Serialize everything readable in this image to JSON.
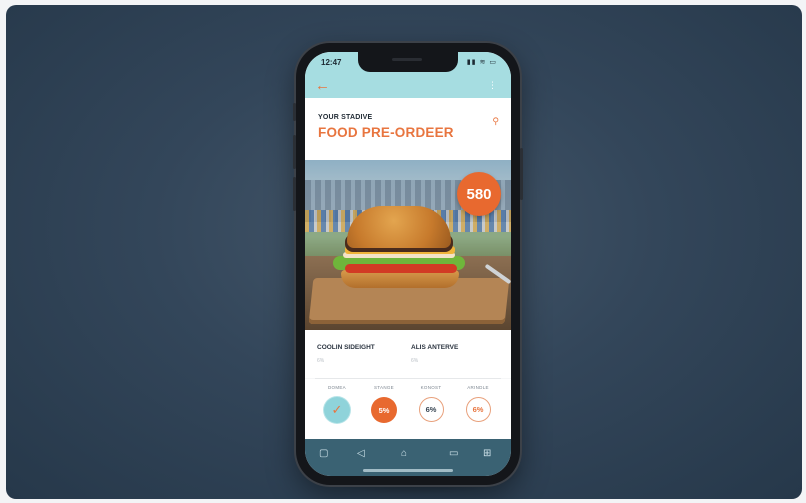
{
  "status_bar": {
    "time": "12:47",
    "icons": "▮▮ ≋ ▭"
  },
  "header": {
    "back_icon": "←",
    "menu_icon": "⋮",
    "supertitle": "YOUR STADIVE",
    "title": "FOOD PRE-ORDEER",
    "pin_icon": "⚲"
  },
  "hero": {
    "price": "580"
  },
  "info": {
    "col1": {
      "label": "COOLIN SIDEIGHT",
      "sub": "6%"
    },
    "col2": {
      "label": "ALIS ANTERVE",
      "sub": "6%"
    }
  },
  "options": [
    {
      "label": "DOMEA",
      "value": "✓",
      "style": "check"
    },
    {
      "label": "STANGE",
      "value": "5%",
      "style": "fill"
    },
    {
      "label": "KONOST",
      "value": "6%",
      "style": "outline-dark"
    },
    {
      "label": "ARINDLE",
      "value": "6%",
      "style": "outline"
    }
  ],
  "navbar": {
    "icons": [
      "▢",
      "◁",
      "⌂",
      "▭",
      "⊞"
    ]
  },
  "colors": {
    "accent": "#e8692f",
    "topbar": "#a6dde1",
    "navbar": "#3a6273",
    "background": "#33465a"
  }
}
